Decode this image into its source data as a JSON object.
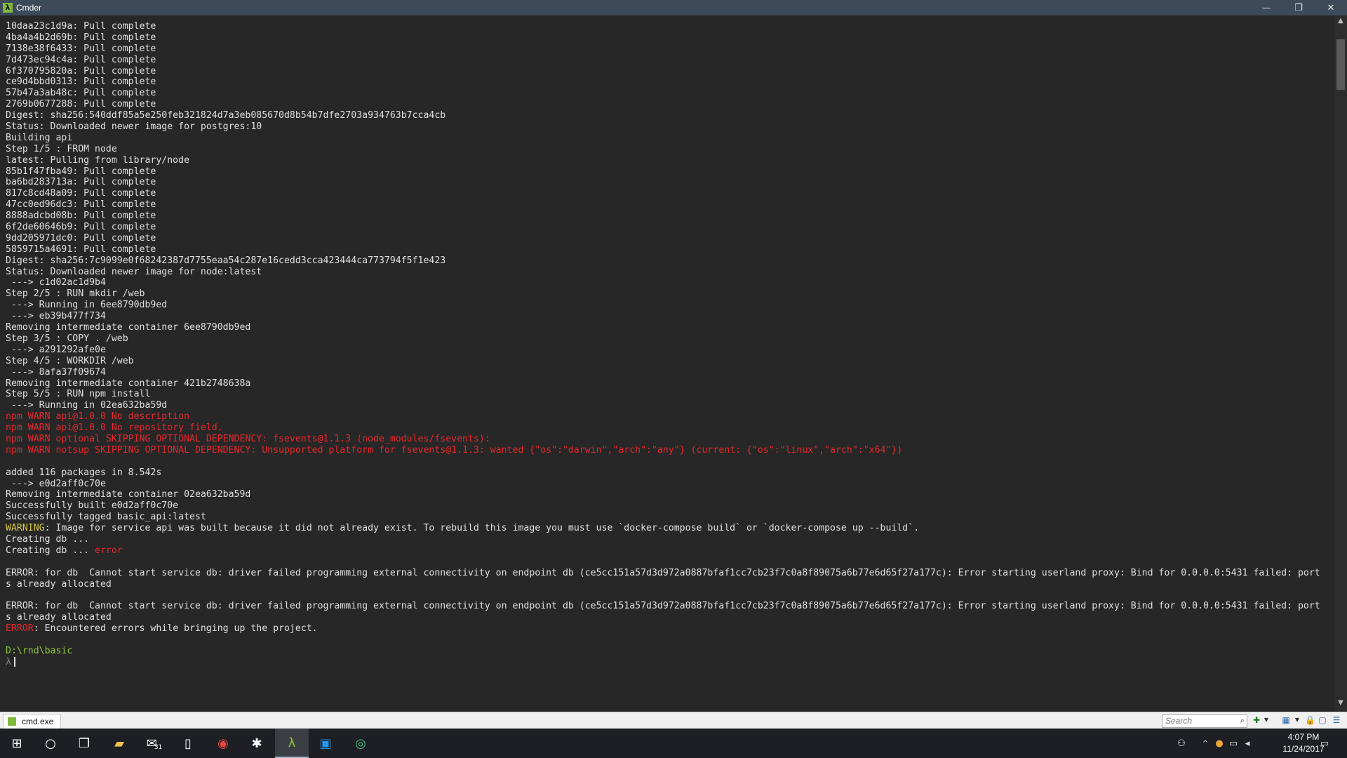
{
  "window": {
    "title": "Cmder",
    "minimize_glyph": "—",
    "maximize_glyph": "❐",
    "close_glyph": "✕",
    "app_icon_glyph": "λ"
  },
  "console": {
    "lines": [
      {
        "text": "10daa23c1d9a: Pull complete",
        "color": "default"
      },
      {
        "text": "4ba4a4b2d69b: Pull complete",
        "color": "default"
      },
      {
        "text": "7138e38f6433: Pull complete",
        "color": "default"
      },
      {
        "text": "7d473ec94c4a: Pull complete",
        "color": "default"
      },
      {
        "text": "6f370795820a: Pull complete",
        "color": "default"
      },
      {
        "text": "ce9d4bbd0313: Pull complete",
        "color": "default"
      },
      {
        "text": "57b47a3ab48c: Pull complete",
        "color": "default"
      },
      {
        "text": "2769b0677288: Pull complete",
        "color": "default"
      },
      {
        "text": "Digest: sha256:540ddf85a5e250feb321824d7a3eb085670d8b54b7dfe2703a934763b7cca4cb",
        "color": "default"
      },
      {
        "text": "Status: Downloaded newer image for postgres:10",
        "color": "default"
      },
      {
        "text": "Building api",
        "color": "default"
      },
      {
        "text": "Step 1/5 : FROM node",
        "color": "default"
      },
      {
        "text": "latest: Pulling from library/node",
        "color": "default"
      },
      {
        "text": "85b1f47fba49: Pull complete",
        "color": "default"
      },
      {
        "text": "ba6bd283713a: Pull complete",
        "color": "default"
      },
      {
        "text": "817c8cd48a09: Pull complete",
        "color": "default"
      },
      {
        "text": "47cc0ed96dc3: Pull complete",
        "color": "default"
      },
      {
        "text": "8888adcbd08b: Pull complete",
        "color": "default"
      },
      {
        "text": "6f2de60646b9: Pull complete",
        "color": "default"
      },
      {
        "text": "9dd205971dc0: Pull complete",
        "color": "default"
      },
      {
        "text": "5859715a4691: Pull complete",
        "color": "default"
      },
      {
        "text": "Digest: sha256:7c9099e0f68242387d7755eaa54c287e16cedd3cca423444ca773794f5f1e423",
        "color": "default"
      },
      {
        "text": "Status: Downloaded newer image for node:latest",
        "color": "default"
      },
      {
        "text": " ---> c1d02ac1d9b4",
        "color": "default"
      },
      {
        "text": "Step 2/5 : RUN mkdir /web",
        "color": "default"
      },
      {
        "text": " ---> Running in 6ee8790db9ed",
        "color": "default"
      },
      {
        "text": " ---> eb39b477f734",
        "color": "default"
      },
      {
        "text": "Removing intermediate container 6ee8790db9ed",
        "color": "default"
      },
      {
        "text": "Step 3/5 : COPY . /web",
        "color": "default"
      },
      {
        "text": " ---> a291292afe0e",
        "color": "default"
      },
      {
        "text": "Step 4/5 : WORKDIR /web",
        "color": "default"
      },
      {
        "text": " ---> 8afa37f09674",
        "color": "default"
      },
      {
        "text": "Removing intermediate container 421b2748638a",
        "color": "default"
      },
      {
        "text": "Step 5/5 : RUN npm install",
        "color": "default"
      },
      {
        "text": " ---> Running in 02ea632ba59d",
        "color": "default"
      },
      {
        "text": "npm WARN api@1.0.0 No description",
        "color": "red"
      },
      {
        "text": "npm WARN api@1.0.0 No repository field.",
        "color": "red"
      },
      {
        "text": "npm WARN optional SKIPPING OPTIONAL DEPENDENCY: fsevents@1.1.3 (node_modules/fsevents):",
        "color": "red"
      },
      {
        "text": "npm WARN notsup SKIPPING OPTIONAL DEPENDENCY: Unsupported platform for fsevents@1.1.3: wanted {\"os\":\"darwin\",\"arch\":\"any\"} (current: {\"os\":\"linux\",\"arch\":\"x64\"})",
        "color": "red"
      },
      {
        "text": "",
        "color": "default"
      },
      {
        "text": "added 116 packages in 8.542s",
        "color": "default"
      },
      {
        "text": " ---> e0d2aff0c70e",
        "color": "default"
      },
      {
        "text": "Removing intermediate container 02ea632ba59d",
        "color": "default"
      },
      {
        "text": "Successfully built e0d2aff0c70e",
        "color": "default"
      },
      {
        "text": "Successfully tagged basic_api:latest",
        "color": "default"
      },
      {
        "segments": [
          {
            "text": "WARNING",
            "color": "yellow"
          },
          {
            "text": ": Image for service api was built because it did not already exist. To rebuild this image you must use `docker-compose build` or `docker-compose up --build`.",
            "color": "default"
          }
        ]
      },
      {
        "text": "Creating db ...",
        "color": "default"
      },
      {
        "segments": [
          {
            "text": "Creating db ... ",
            "color": "default"
          },
          {
            "text": "error",
            "color": "red"
          }
        ]
      },
      {
        "text": "",
        "color": "default"
      },
      {
        "text": "ERROR: for db  Cannot start service db: driver failed programming external connectivity on endpoint db (ce5cc151a57d3d972a0887bfaf1cc7cb23f7c0a8f89075a6b77e6d65f27a177c): Error starting userland proxy: Bind for 0.0.0.0:5431 failed: port",
        "color": "default"
      },
      {
        "text": "s already allocated",
        "color": "default"
      },
      {
        "text": "",
        "color": "default"
      },
      {
        "text": "ERROR: for db  Cannot start service db: driver failed programming external connectivity on endpoint db (ce5cc151a57d3d972a0887bfaf1cc7cb23f7c0a8f89075a6b77e6d65f27a177c): Error starting userland proxy: Bind for 0.0.0.0:5431 failed: port",
        "color": "default"
      },
      {
        "text": "s already allocated",
        "color": "default"
      },
      {
        "segments": [
          {
            "text": "ERROR",
            "color": "red"
          },
          {
            "text": ": Encountered errors while bringing up the project.",
            "color": "default"
          }
        ]
      },
      {
        "text": "",
        "color": "default"
      },
      {
        "text": "D:\\rnd\\basic",
        "color": "green"
      },
      {
        "text": "λ",
        "color": "dim",
        "cursor": true
      }
    ],
    "colors": {
      "default": "#e0e0e0",
      "red": "#e8262c",
      "yellow": "#d4c942",
      "green": "#8fc93a",
      "dim": "#888888"
    }
  },
  "tabbar": {
    "tab_label": "cmd.exe",
    "search_placeholder": "Search",
    "search_icon": "magnifier-icon"
  },
  "taskbar": {
    "apps": [
      "windows-start-icon",
      "cortana-icon",
      "task-view-icon",
      "file-explorer-icon",
      "mail-icon",
      "documents-icon",
      "chrome-icon",
      "slack-icon",
      "cmder-icon",
      "docker-icon",
      "gitkraken-icon"
    ],
    "mail_badge": "31",
    "time": "4:07 PM",
    "date": "11/24/2017"
  }
}
